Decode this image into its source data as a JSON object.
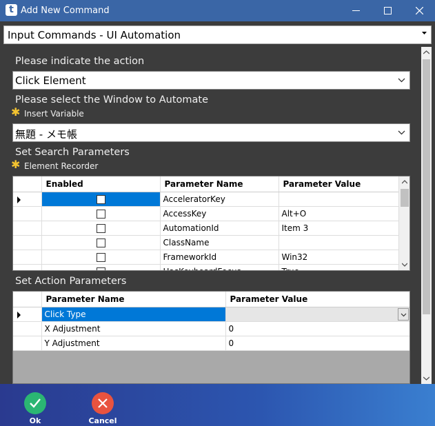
{
  "window": {
    "app_icon_letter": "t",
    "title": "Add New Command"
  },
  "command_select": {
    "value": "Input Commands - UI Automation"
  },
  "action": {
    "label": "Please indicate the action",
    "value": "Click Element"
  },
  "window_select": {
    "label": "Please select the Window to Automate",
    "insert_variable_label": "Insert Variable",
    "value": "無題 - メモ帳"
  },
  "search_params": {
    "label": "Set Search Parameters",
    "recorder_label": "Element Recorder",
    "columns": [
      "Enabled",
      "Parameter Name",
      "Parameter Value"
    ],
    "rows": [
      {
        "enabled": false,
        "name": "AcceleratorKey",
        "value": ""
      },
      {
        "enabled": false,
        "name": "AccessKey",
        "value": "Alt+O"
      },
      {
        "enabled": false,
        "name": "AutomationId",
        "value": "Item 3"
      },
      {
        "enabled": false,
        "name": "ClassName",
        "value": ""
      },
      {
        "enabled": false,
        "name": "FrameworkId",
        "value": "Win32"
      },
      {
        "enabled": false,
        "name": "HasKeyboardFocus",
        "value": "True"
      }
    ]
  },
  "action_params": {
    "label": "Set Action Parameters",
    "columns": [
      "Parameter Name",
      "Parameter Value"
    ],
    "rows": [
      {
        "name": "Click Type",
        "value": ""
      },
      {
        "name": "X Adjustment",
        "value": "0"
      },
      {
        "name": "Y Adjustment",
        "value": "0"
      }
    ]
  },
  "buttons": {
    "ok": "Ok",
    "cancel": "Cancel"
  },
  "colors": {
    "titlebar": "#3a66a6",
    "selection": "#0078d7",
    "ok_green": "#2bb673",
    "cancel_red": "#e8533f",
    "star": "#f4c430"
  }
}
